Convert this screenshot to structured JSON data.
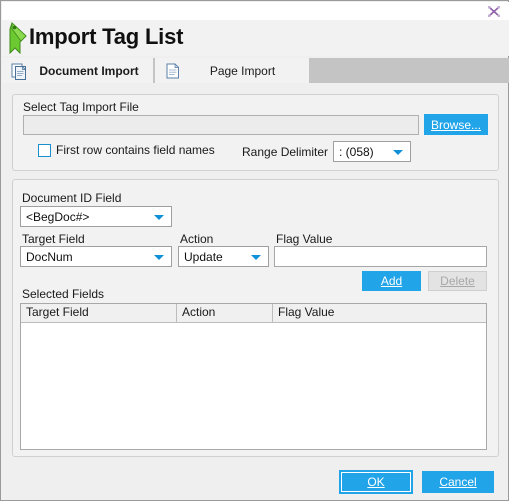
{
  "window": {
    "title": "Import Tag List",
    "close_label": "close",
    "app_icon": "green-tag-icon"
  },
  "tabs": [
    {
      "label": "Document Import",
      "icon": "documents-icon",
      "active": true
    },
    {
      "label": "Page Import",
      "icon": "page-icon",
      "active": false
    }
  ],
  "file_group": {
    "legend": "Select Tag Import File",
    "path_value": "",
    "path_placeholder": "",
    "browse_label": "Browse...",
    "first_row_label": "First row contains field names",
    "first_row_checked": false,
    "range_delimiter_label": "Range Delimiter",
    "range_delimiter_value": ": (058)"
  },
  "fields_group": {
    "document_id_label": "Document ID Field",
    "document_id_value": "<BegDoc#>",
    "target_field_label": "Target Field",
    "target_field_value": "DocNum",
    "action_label": "Action",
    "action_value": "Update",
    "flag_value_label": "Flag Value",
    "flag_value_value": "",
    "add_label": "Add",
    "delete_label": "Delete",
    "delete_enabled": false,
    "selected_fields_label": "Selected Fields",
    "table": {
      "columns": [
        "Target Field",
        "Action",
        "Flag Value"
      ],
      "rows": []
    }
  },
  "footer": {
    "ok_label": "OK",
    "cancel_label": "Cancel"
  },
  "colors": {
    "accent_blue": "#21a4e8",
    "tabstrip_gray": "#c4c4c4",
    "panel_gray": "#f2f2f2",
    "icon_green": "#5cc22a"
  }
}
